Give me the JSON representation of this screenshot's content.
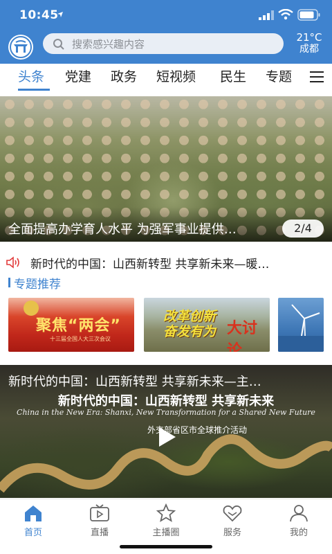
{
  "status": {
    "time": "10:45"
  },
  "header": {
    "search_placeholder": "搜索感兴趣内容",
    "weather_temp": "21°C",
    "weather_city": "成都"
  },
  "tabs": [
    {
      "label": "头条",
      "active": true
    },
    {
      "label": "党建"
    },
    {
      "label": "政务"
    },
    {
      "label": "短视频"
    },
    {
      "label": "民生"
    },
    {
      "label": "专题"
    }
  ],
  "hero": {
    "caption": "全面提高办学育人水平 为强军事业提供…",
    "page": "2/4"
  },
  "notice": {
    "text": "新时代的中国：山西新转型 共享新未来—暖…"
  },
  "topics": {
    "title": "专题推荐",
    "cards": [
      {
        "text": "聚焦“两会”",
        "subtext": "十三届全国人大三次会议"
      },
      {
        "text": "改革创新 奋发有为",
        "text2": "大讨论"
      },
      {
        "text": ""
      }
    ]
  },
  "video": {
    "title": "新时代的中国：山西新转型 共享新未来—主…",
    "overlay_cn": "新时代的中国：山西新转型 共享新未来",
    "overlay_en": "China in the New Era: Shanxi, New Transformation for a Shared New Future",
    "overlay_sub": "外交部省区市全球推介活动"
  },
  "bottom_nav": [
    {
      "label": "首页",
      "icon": "home-icon",
      "active": true
    },
    {
      "label": "直播",
      "icon": "tv-icon"
    },
    {
      "label": "主播圈",
      "icon": "star-icon"
    },
    {
      "label": "服务",
      "icon": "heart-icon"
    },
    {
      "label": "我的",
      "icon": "user-icon"
    }
  ],
  "colors": {
    "brand": "#3f83cf",
    "header_bg": "#3f83cf",
    "notice_icon": "#e23b3b"
  }
}
